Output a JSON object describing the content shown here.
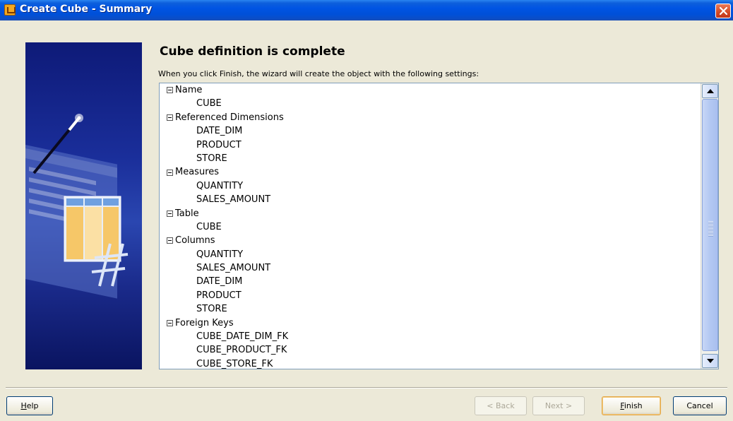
{
  "window": {
    "title": "Create Cube - Summary",
    "close_label": "×"
  },
  "page": {
    "heading": "Cube definition is complete",
    "description": "When you click Finish, the wizard will create the object with the following settings:"
  },
  "tree": [
    {
      "label": "Name",
      "items": [
        "CUBE"
      ]
    },
    {
      "label": "Referenced Dimensions",
      "items": [
        "DATE_DIM",
        "PRODUCT",
        "STORE"
      ]
    },
    {
      "label": "Measures",
      "items": [
        "QUANTITY",
        "SALES_AMOUNT"
      ]
    },
    {
      "label": "Table",
      "items": [
        "CUBE"
      ]
    },
    {
      "label": "Columns",
      "items": [
        "QUANTITY",
        "SALES_AMOUNT",
        "DATE_DIM",
        "PRODUCT",
        "STORE"
      ]
    },
    {
      "label": "Foreign Keys",
      "items": [
        "CUBE_DATE_DIM_FK",
        "CUBE_PRODUCT_FK",
        "CUBE_STORE_FK"
      ]
    }
  ],
  "buttons": {
    "help": "Help",
    "back": "< Back",
    "next": "Next >",
    "finish": "Finish",
    "cancel": "Cancel"
  },
  "colors": {
    "titlebar": "#0054e3",
    "dialog_bg": "#ece9d8",
    "wizard_panel": "#1a2e9a",
    "close_button": "#d34a25"
  },
  "icons": {
    "app": "cube-wizard-icon",
    "close": "close-icon",
    "expander": "collapse-minus-icon",
    "scroll_up": "arrow-up-icon",
    "scroll_down": "arrow-down-icon"
  }
}
